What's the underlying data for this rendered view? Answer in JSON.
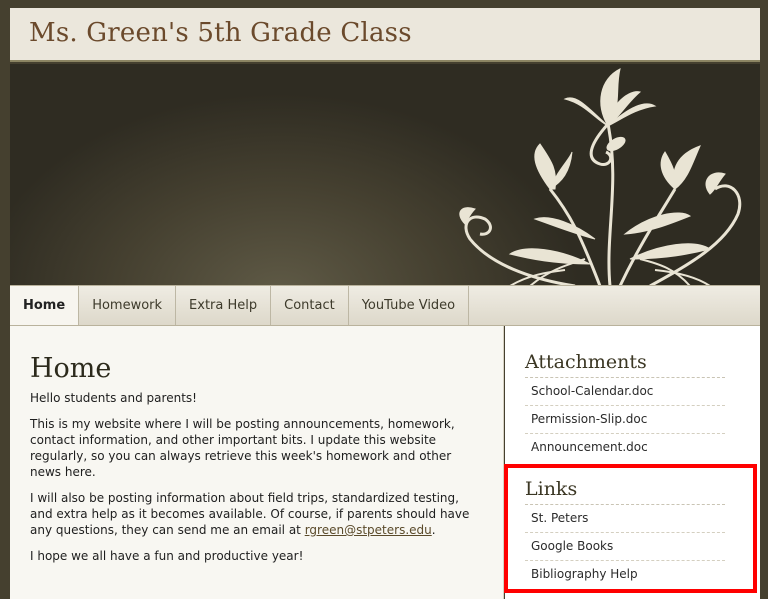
{
  "site": {
    "title": "Ms. Green's 5th Grade Class"
  },
  "nav": {
    "tabs": [
      {
        "label": "Home",
        "active": true
      },
      {
        "label": "Homework"
      },
      {
        "label": "Extra Help"
      },
      {
        "label": "Contact"
      },
      {
        "label": "YouTube Video"
      }
    ]
  },
  "main": {
    "heading": "Home",
    "p1": "Hello students and parents!",
    "p2": "This is my website where I will be posting announcements, homework, contact information, and other important bits. I update this website regularly, so you can always retrieve this week's homework and other news here.",
    "p3_before": "I will also be posting information about field trips, standardized testing, and extra help as it becomes available. Of course, if parents should have any questions, they can send me an email at ",
    "p3_link": "rgreen@stpeters.edu",
    "p3_after": ".",
    "p4": "I hope we all have a fun and productive year!"
  },
  "sidebar": {
    "attachments": {
      "heading": "Attachments",
      "items": [
        "School-Calendar.doc",
        "Permission-Slip.doc",
        "Announcement.doc"
      ]
    },
    "links": {
      "heading": "Links",
      "items": [
        "St. Peters",
        "Google Books",
        "Bibliography Help"
      ]
    }
  },
  "colors": {
    "highlight": "#ff0000",
    "banner_ornament": "#e9e4d4"
  }
}
